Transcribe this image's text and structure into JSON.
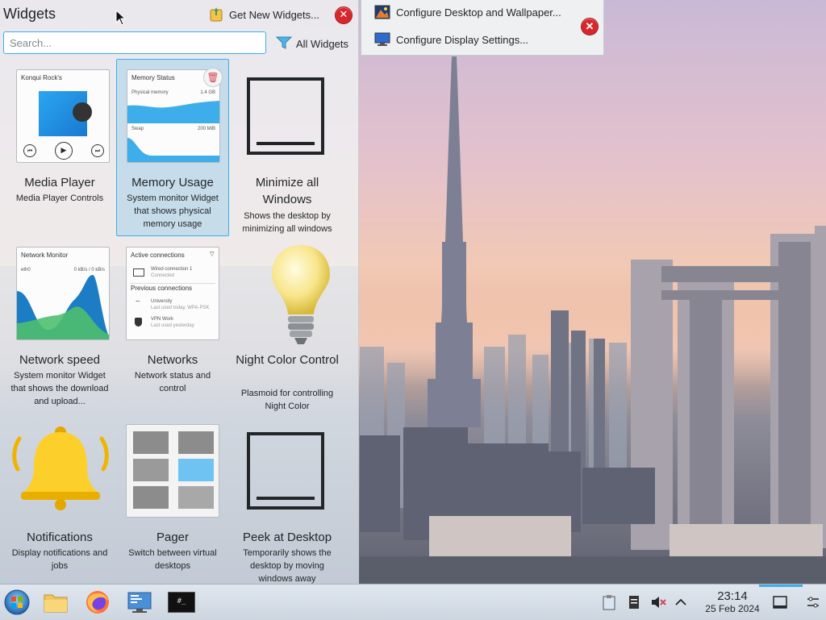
{
  "panel": {
    "title": "Widgets",
    "get_new_label": "Get New Widgets...",
    "search_placeholder": "Search...",
    "search_value": "",
    "filter_label": "All Widgets"
  },
  "widgets": [
    {
      "name": "Media Player",
      "desc": "Media Player Controls",
      "card_title": "Konqui Rock's"
    },
    {
      "name": "Memory Usage",
      "desc": "System monitor Widget that shows physical memory usage",
      "card_title": "Memory Status",
      "phys_label": "Physical memory",
      "phys_val": "1.4 GB",
      "swap_label": "Swap",
      "swap_val": "200 MiB"
    },
    {
      "name": "Minimize all Windows",
      "desc": "Shows the desktop by minimizing all windows"
    },
    {
      "name": "Network speed",
      "desc": "System monitor Widget that shows the download and upload...",
      "card_title": "Network Monitor",
      "iface": "eth0",
      "rate": "0 kB/s / 0 kB/s"
    },
    {
      "name": "Networks",
      "desc": "Network status and control",
      "card_title": "Active connections",
      "conn1": "Wired connection 1",
      "conn1_sub": "Connected",
      "prev": "Previous connections",
      "conn2": "University",
      "conn2_sub": "Last used today, WPA-PSK",
      "conn3": "VPN Work",
      "conn3_sub": "Last used yesterday"
    },
    {
      "name": "Night Color Control",
      "desc": "Plasmoid for controlling Night Color"
    },
    {
      "name": "Notifications",
      "desc": "Display notifications and jobs"
    },
    {
      "name": "Pager",
      "desc": "Switch between virtual desktops"
    },
    {
      "name": "Peek at Desktop",
      "desc": "Temporarily shows the desktop by moving windows away"
    }
  ],
  "context_menu": {
    "items": [
      {
        "label": "Configure Desktop and Wallpaper...",
        "icon": "desktop-wallpaper-icon"
      },
      {
        "label": "Configure Display Settings...",
        "icon": "display-settings-icon"
      }
    ]
  },
  "taskbar": {
    "apps": [
      {
        "name": "start-menu",
        "icon": "start-orb-icon"
      },
      {
        "name": "file-manager",
        "icon": "folder-icon"
      },
      {
        "name": "firefox",
        "icon": "firefox-icon"
      },
      {
        "name": "system-settings",
        "icon": "system-settings-icon"
      },
      {
        "name": "terminal",
        "icon": "terminal-icon"
      }
    ],
    "terminal_glyph": "#_",
    "clock_time": "23:14",
    "clock_date": "25 Feb 2024"
  },
  "colors": {
    "accent": "#3daee9",
    "close": "#d9262b",
    "panel_bg": "#eff0f1"
  }
}
